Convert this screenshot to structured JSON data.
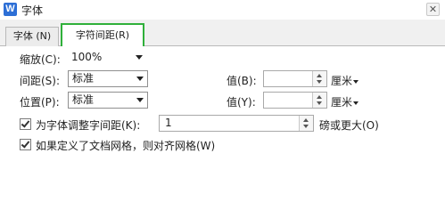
{
  "window": {
    "title": "字体",
    "app_icon_letter": "W"
  },
  "tabs": [
    {
      "label": "字体 (N)",
      "active": false
    },
    {
      "label": "字符间距(R)",
      "active": true
    }
  ],
  "form": {
    "scale": {
      "label": "缩放(C):",
      "value": "100%"
    },
    "spacing": {
      "label": "间距(S):",
      "value": "标准",
      "value_label": "值(B):",
      "value_input": "",
      "unit": "厘米"
    },
    "position": {
      "label": "位置(P):",
      "value": "标准",
      "value_label": "值(Y):",
      "value_input": "",
      "unit": "厘米"
    },
    "kerning": {
      "label": "为字体调整字间距(K):",
      "checked": true,
      "value": "1",
      "suffix": "磅或更大(O)"
    },
    "grid": {
      "label": "如果定义了文档网格，则对齐网格(W)",
      "checked": true
    }
  },
  "colors": {
    "highlight": "#2fb03a",
    "app_icon": "#2d6fd6"
  }
}
